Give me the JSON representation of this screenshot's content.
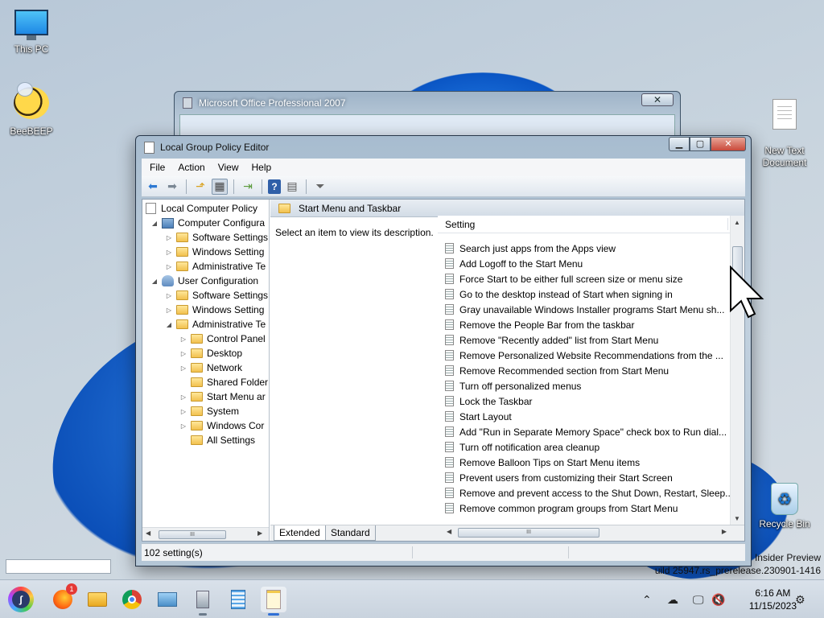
{
  "desktop": {
    "icons": [
      {
        "label": "This PC"
      },
      {
        "label": "BeeBEEP"
      },
      {
        "label": "New Text\nDocument"
      },
      {
        "label": "Recycle Bin"
      }
    ],
    "watermark": {
      "line1": "Insider Preview",
      "line2": "uild 25947.rs_prerelease.230901-1416"
    }
  },
  "office_window": {
    "title": "Microsoft Office Professional 2007",
    "close": "✕"
  },
  "gpe_window": {
    "title": "Local Group Policy Editor",
    "buttons": {
      "min": "▁",
      "max": "▢",
      "close": "✕"
    },
    "menu": [
      "File",
      "Action",
      "View",
      "Help"
    ],
    "tree": [
      {
        "label": "Local Computer Policy",
        "indent": 0,
        "toggle": "",
        "icon": "page"
      },
      {
        "label": "Computer Configura",
        "indent": 1,
        "toggle": "◢",
        "icon": "pc"
      },
      {
        "label": "Software Settings",
        "indent": 2,
        "toggle": "▷",
        "icon": "folder"
      },
      {
        "label": "Windows Setting",
        "indent": 2,
        "toggle": "▷",
        "icon": "folder"
      },
      {
        "label": "Administrative Te",
        "indent": 2,
        "toggle": "▷",
        "icon": "folder"
      },
      {
        "label": "User Configuration",
        "indent": 1,
        "toggle": "◢",
        "icon": "user"
      },
      {
        "label": "Software Settings",
        "indent": 2,
        "toggle": "▷",
        "icon": "folder"
      },
      {
        "label": "Windows Setting",
        "indent": 2,
        "toggle": "▷",
        "icon": "folder"
      },
      {
        "label": "Administrative Te",
        "indent": 2,
        "toggle": "◢",
        "icon": "folder"
      },
      {
        "label": "Control Panel",
        "indent": 3,
        "toggle": "▷",
        "icon": "folder"
      },
      {
        "label": "Desktop",
        "indent": 3,
        "toggle": "▷",
        "icon": "folder"
      },
      {
        "label": "Network",
        "indent": 3,
        "toggle": "▷",
        "icon": "folder"
      },
      {
        "label": "Shared Folder",
        "indent": 3,
        "toggle": "",
        "icon": "folder"
      },
      {
        "label": "Start Menu ar",
        "indent": 3,
        "toggle": "▷",
        "icon": "folder"
      },
      {
        "label": "System",
        "indent": 3,
        "toggle": "▷",
        "icon": "folder"
      },
      {
        "label": "Windows Cor",
        "indent": 3,
        "toggle": "▷",
        "icon": "folder"
      },
      {
        "label": "All Settings",
        "indent": 3,
        "toggle": "",
        "icon": "allsettings"
      }
    ],
    "right_header": "Start Menu and Taskbar",
    "description": "Select an item to view its description.",
    "column_header": "Setting",
    "settings": [
      "Search just apps from the Apps view",
      "Add Logoff to the Start Menu",
      "Force Start to be either full screen size or menu size",
      "Go to the desktop instead of Start when signing in",
      "Gray unavailable Windows Installer programs Start Menu sh...",
      "Remove the People Bar from the taskbar",
      "Remove \"Recently added\" list from Start Menu",
      "Remove Personalized Website Recommendations from the ...",
      "Remove Recommended section from Start Menu",
      "Turn off personalized menus",
      "Lock the Taskbar",
      "Start Layout",
      "Add \"Run in Separate Memory Space\" check box to Run dial...",
      "Turn off notification area cleanup",
      "Remove Balloon Tips on Start Menu items",
      "Prevent users from customizing their Start Screen",
      "Remove and prevent access to the Shut Down, Restart, Sleep...",
      "Remove common program groups from Start Menu"
    ],
    "tabs": [
      "Extended",
      "Standard"
    ],
    "status": "102 setting(s)"
  },
  "taskbar": {
    "badge": "1",
    "time": "6:16 AM",
    "date": "11/15/2023"
  }
}
